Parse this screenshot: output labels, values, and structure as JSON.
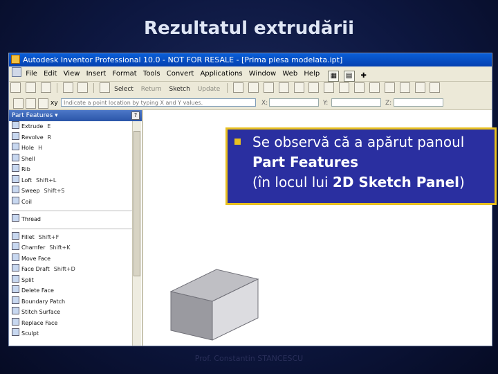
{
  "slide": {
    "title": "Rezultatul extrudării",
    "footer": "Prof. Constantin STANCESCU"
  },
  "window": {
    "title": "Autodesk Inventor Professional 10.0 - NOT FOR RESALE - [Prima piesa modelata.ipt]"
  },
  "menu": {
    "items": [
      "File",
      "Edit",
      "View",
      "Insert",
      "Format",
      "Tools",
      "Convert",
      "Applications",
      "Window",
      "Web",
      "Help"
    ]
  },
  "toolbar": {
    "select_label": "Select",
    "return_label": "Return",
    "sketch_label": "Sketch",
    "update_label": "Update"
  },
  "inputbar": {
    "xy_label": "xy",
    "hint": "Indicate a point location by typing X and Y values.",
    "x_label": "X:",
    "y_label": "Y:",
    "z_label": "Z:"
  },
  "panel": {
    "title": "Part Features ▾",
    "help_glyph": "?",
    "group1": [
      {
        "label": "Extrude",
        "shortcut": "E"
      },
      {
        "label": "Revolve",
        "shortcut": "R"
      },
      {
        "label": "Hole",
        "shortcut": "H"
      },
      {
        "label": "Shell",
        "shortcut": ""
      },
      {
        "label": "Rib",
        "shortcut": ""
      },
      {
        "label": "Loft",
        "shortcut": "Shift+L"
      },
      {
        "label": "Sweep",
        "shortcut": "Shift+S"
      },
      {
        "label": "Coil",
        "shortcut": ""
      }
    ],
    "group2": [
      {
        "label": "Thread",
        "shortcut": ""
      }
    ],
    "group3": [
      {
        "label": "Fillet",
        "shortcut": "Shift+F"
      },
      {
        "label": "Chamfer",
        "shortcut": "Shift+K"
      },
      {
        "label": "Move Face",
        "shortcut": ""
      },
      {
        "label": "Face Draft",
        "shortcut": "Shift+D"
      },
      {
        "label": "Split",
        "shortcut": ""
      },
      {
        "label": "Delete Face",
        "shortcut": ""
      },
      {
        "label": "Boundary Patch",
        "shortcut": ""
      },
      {
        "label": "Stitch Surface",
        "shortcut": ""
      },
      {
        "label": "Replace Face",
        "shortcut": ""
      },
      {
        "label": "Sculpt",
        "shortcut": ""
      }
    ]
  },
  "callout": {
    "line1": "Se observă că a apărut panoul",
    "line2": "Part Features",
    "line3_prefix": "(în locul lui ",
    "line3_bold": "2D Sketch Panel",
    "line3_suffix": ")"
  },
  "colors": {
    "background": "#0d1740",
    "title_text": "#dfe6f5",
    "callout_bg": "#2a2fa0",
    "callout_border": "#e8c020",
    "window_titlebar": "#0a5fd8",
    "panel_header": "#2a55a8"
  }
}
